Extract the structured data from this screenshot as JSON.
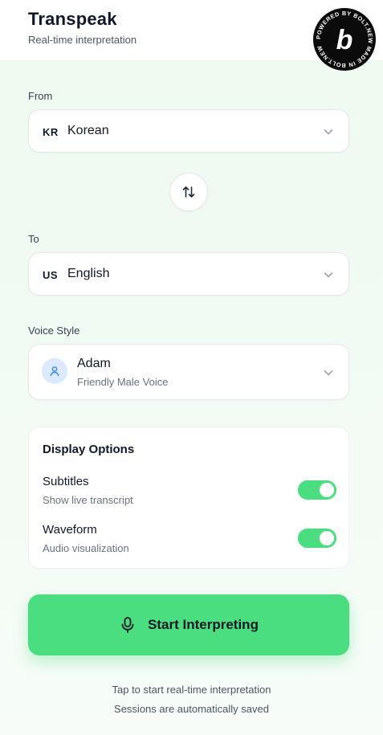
{
  "header": {
    "title": "Transpeak",
    "subtitle": "Real-time interpretation"
  },
  "badge": {
    "ring_text": "POWERED BY BOLT.NEW MADE IN BOLT.NEW",
    "letter": "b"
  },
  "from": {
    "label": "From",
    "code": "KR",
    "language": "Korean"
  },
  "to": {
    "label": "To",
    "code": "US",
    "language": "English"
  },
  "voice": {
    "label": "Voice Style",
    "name": "Adam",
    "description": "Friendly Male Voice"
  },
  "display_options": {
    "title": "Display Options",
    "items": [
      {
        "name": "Subtitles",
        "description": "Show live transcript",
        "enabled": true
      },
      {
        "name": "Waveform",
        "description": "Audio visualization",
        "enabled": true
      }
    ]
  },
  "start_button": {
    "label": "Start Interpreting"
  },
  "footer": {
    "line1": "Tap to start real-time interpretation",
    "line2": "Sessions are automatically saved"
  },
  "colors": {
    "accent": "#4ade80",
    "avatar_bg": "#dbeafe",
    "avatar_icon": "#3b82f6",
    "background": "#eefaf0"
  },
  "icons": {
    "swap": "swap-vertical-icon",
    "chevron": "chevron-down-icon",
    "user": "user-icon",
    "mic": "microphone-icon"
  }
}
